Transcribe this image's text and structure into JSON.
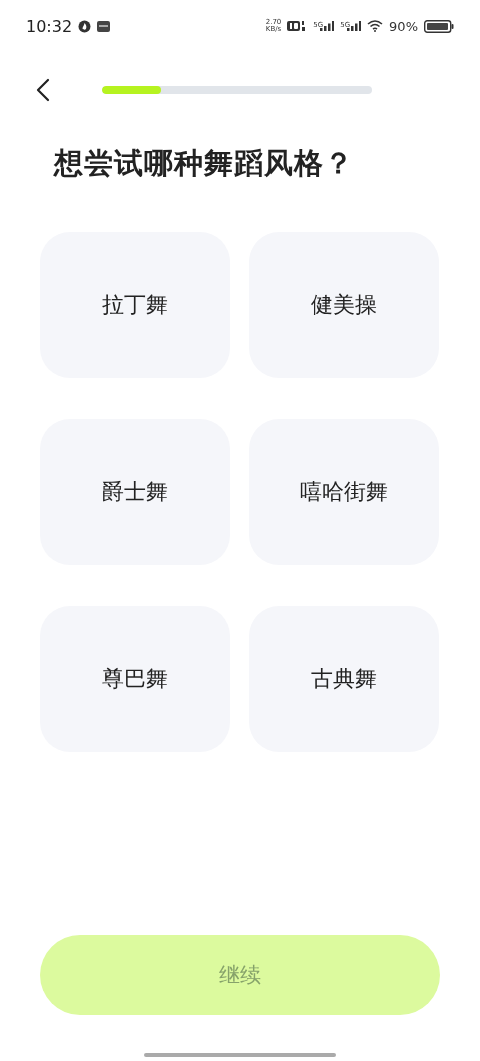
{
  "status_bar": {
    "time": "10:32",
    "net_speed": "2.70",
    "net_unit": "KB/s",
    "sim_1": "5G",
    "sim_2": "5G",
    "battery": "90%"
  },
  "progress": {
    "level": 0.22
  },
  "title": "想尝试哪种舞蹈风格？",
  "options": [
    {
      "label": "拉丁舞",
      "selected": false
    },
    {
      "label": "健美操",
      "selected": false
    },
    {
      "label": "爵士舞",
      "selected": false
    },
    {
      "label": "嘻哈街舞",
      "selected": false
    },
    {
      "label": "尊巴舞",
      "selected": false
    },
    {
      "label": "古典舞",
      "selected": false
    }
  ],
  "continue_button": {
    "label": "继续",
    "disabled": true
  }
}
